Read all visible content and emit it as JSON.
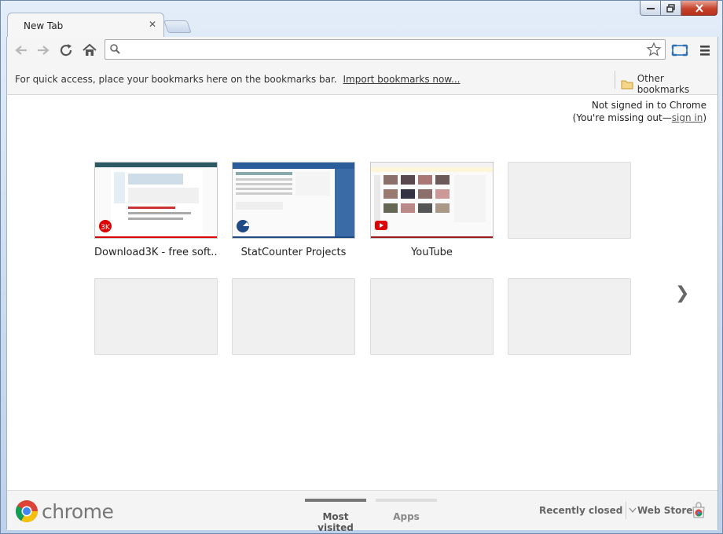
{
  "window": {
    "tab_title": "New Tab",
    "minimize_label": "–",
    "maximize_label": "□",
    "close_label": "✕"
  },
  "bookmarks_bar": {
    "hint": "For quick access, place your bookmarks here on the bookmarks bar.",
    "import_link": "Import bookmarks now...",
    "other_bookmarks": "Other bookmarks"
  },
  "omnibox": {
    "value": "",
    "placeholder": ""
  },
  "signin": {
    "line1": "Not signed in to Chrome",
    "line2_prefix": "(You're missing out—",
    "link": "sign in",
    "line2_suffix": ")"
  },
  "most_visited": {
    "tiles": [
      {
        "title": "Download3K - free soft...",
        "accent": "#d00000"
      },
      {
        "title": "StatCounter Projects",
        "accent": "#1e4a86"
      },
      {
        "title": "YouTube",
        "accent": "#9b1a1a"
      }
    ],
    "next_arrow": "❯"
  },
  "footer": {
    "logo_text": "chrome",
    "tab_most_visited": "Most visited",
    "tab_apps": "Apps",
    "recently_closed": "Recently closed",
    "web_store": "Web Store"
  },
  "colors": {
    "accent_dark": "#777777",
    "accent_light": "#cccccc"
  }
}
